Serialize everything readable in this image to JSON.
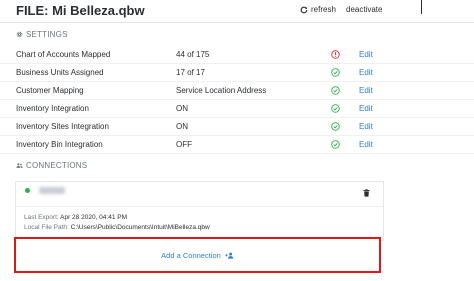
{
  "header": {
    "file_title": "FILE: Mi Belleza.qbw",
    "refresh_label": "refresh",
    "deactivate_label": "deactivate"
  },
  "settings": {
    "heading": "SETTINGS",
    "edit_label": "Edit",
    "rows": [
      {
        "label": "Chart of Accounts Mapped",
        "value": "44 of 175",
        "status": "warning",
        "status_color": "#d9303a"
      },
      {
        "label": "Business Units Assigned",
        "value": "17 of 17",
        "status": "ok",
        "status_color": "#2fb14a"
      },
      {
        "label": "Customer Mapping",
        "value": "Service Location Address",
        "status": "ok",
        "status_color": "#2fb14a"
      },
      {
        "label": "Inventory Integration",
        "value": "ON",
        "status": "ok",
        "status_color": "#2fb14a"
      },
      {
        "label": "Inventory Sites Integration",
        "value": "ON",
        "status": "ok",
        "status_color": "#2fb14a"
      },
      {
        "label": "Inventory Bin Integration",
        "value": "OFF",
        "status": "ok",
        "status_color": "#2fb14a"
      }
    ]
  },
  "connections": {
    "heading": "CONNECTIONS",
    "card": {
      "status_color": "#2fb14a",
      "last_export_label": "Last Export:",
      "last_export_value": "Apr 28 2020, 04:41 PM",
      "local_path_label": "Local File Path:",
      "local_path_value": "C:\\Users\\Public\\Documents\\Intuit\\MiBelleza.qbw"
    },
    "add_label": "Add a Connection",
    "highlight_color": "#e0161b"
  }
}
